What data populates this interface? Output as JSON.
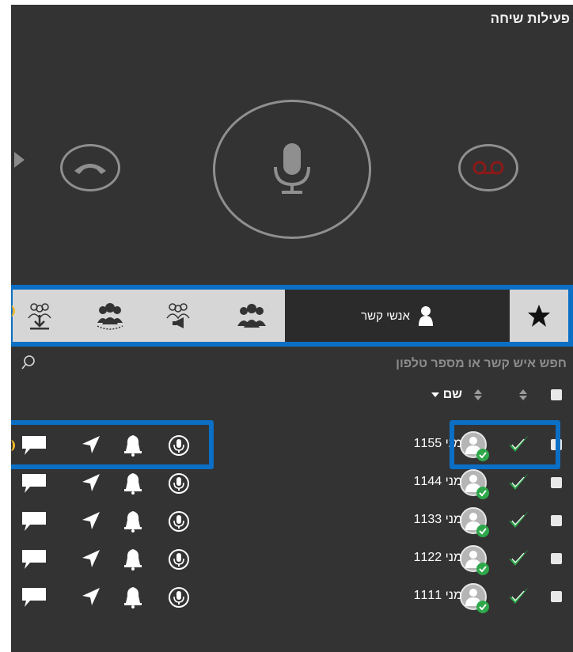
{
  "call_actions": {
    "title": "פעילות שיחה",
    "hangup_icon": "phone-hangup-icon",
    "mic_icon": "microphone-icon",
    "voicemail_icon": "voicemail-icon"
  },
  "tabs": {
    "favorites_icon": "star-icon",
    "contacts_label": "אנשי קשר",
    "contacts_icon": "person-icon",
    "icon_tabs": [
      "group-icon",
      "group-broadcast-icon",
      "group-conference-icon",
      "group-download-icon"
    ]
  },
  "search": {
    "placeholder": "חפש איש קשר או מספר טלפון"
  },
  "list_header": {
    "name_label": "שם"
  },
  "contacts": [
    {
      "name": "מני 1155"
    },
    {
      "name": "מני 1144"
    },
    {
      "name": "מני 1133"
    },
    {
      "name": "מני 1122"
    },
    {
      "name": "מני 1111"
    }
  ],
  "row_actions": [
    "microphone-icon",
    "bell-icon",
    "location-arrow-icon",
    "chat-bubble-icon"
  ],
  "colors": {
    "background": "#333333",
    "accent_blue": "#0b6fc5",
    "status_green": "#2ea84a",
    "voicemail_red": "#8b1a1a"
  }
}
